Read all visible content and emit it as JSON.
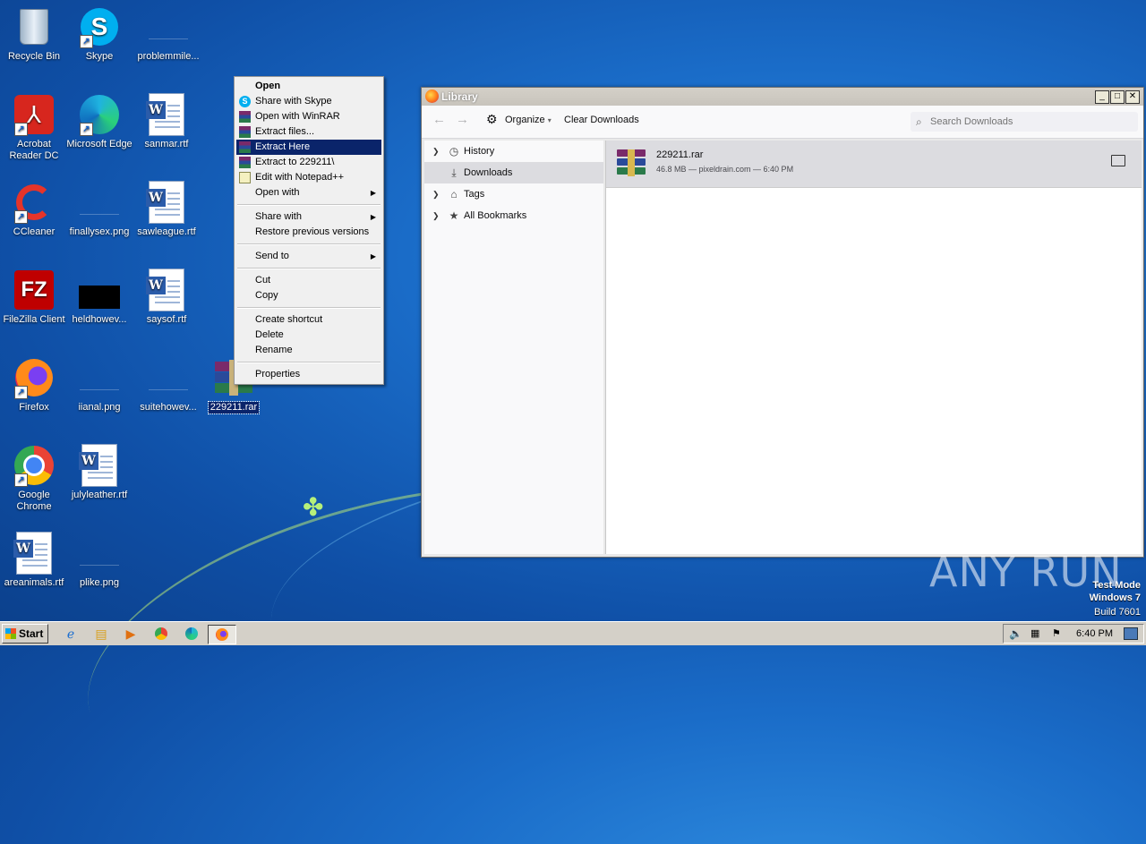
{
  "desktop": {
    "icons": [
      {
        "label": "Recycle Bin"
      },
      {
        "label": "Skype"
      },
      {
        "label": "problemmile..."
      },
      {
        "label": "Acrobat Reader DC"
      },
      {
        "label": "Microsoft Edge"
      },
      {
        "label": "sanmar.rtf"
      },
      {
        "label": "CCleaner"
      },
      {
        "label": "finallysex.png"
      },
      {
        "label": "sawleague.rtf"
      },
      {
        "label": "FileZilla Client"
      },
      {
        "label": "heldhowev..."
      },
      {
        "label": "saysof.rtf"
      },
      {
        "label": "Firefox"
      },
      {
        "label": "iianal.png"
      },
      {
        "label": "suitehowev..."
      },
      {
        "label": "229211.rar"
      },
      {
        "label": "Google Chrome"
      },
      {
        "label": "julyleather.rtf"
      },
      {
        "label": "areanimals.rtf"
      },
      {
        "label": "plike.png"
      }
    ]
  },
  "context_menu": {
    "items": [
      {
        "label": "Open"
      },
      {
        "label": "Share with Skype"
      },
      {
        "label": "Open with WinRAR"
      },
      {
        "label": "Extract files..."
      },
      {
        "label": "Extract Here"
      },
      {
        "label": "Extract to 229211\\"
      },
      {
        "label": "Edit with Notepad++"
      },
      {
        "label": "Open with"
      },
      {
        "label": "Share with"
      },
      {
        "label": "Restore previous versions"
      },
      {
        "label": "Send to"
      },
      {
        "label": "Cut"
      },
      {
        "label": "Copy"
      },
      {
        "label": "Create shortcut"
      },
      {
        "label": "Delete"
      },
      {
        "label": "Rename"
      },
      {
        "label": "Properties"
      }
    ]
  },
  "library": {
    "title": "Library",
    "organize": "Organize",
    "clear_downloads": "Clear Downloads",
    "search_placeholder": "Search Downloads",
    "sidebar": [
      {
        "label": "History"
      },
      {
        "label": "Downloads"
      },
      {
        "label": "Tags"
      },
      {
        "label": "All Bookmarks"
      }
    ],
    "download": {
      "filename": "229211.rar",
      "details": "46.8 MB — pixeldrain.com — 6:40 PM"
    }
  },
  "watermark": {
    "brand": "ANY RUN",
    "mode_line1": "Test Mode",
    "mode_line2": "Windows 7",
    "mode_line3": "Build 7601"
  },
  "taskbar": {
    "start": "Start",
    "clock": "6:40 PM"
  }
}
